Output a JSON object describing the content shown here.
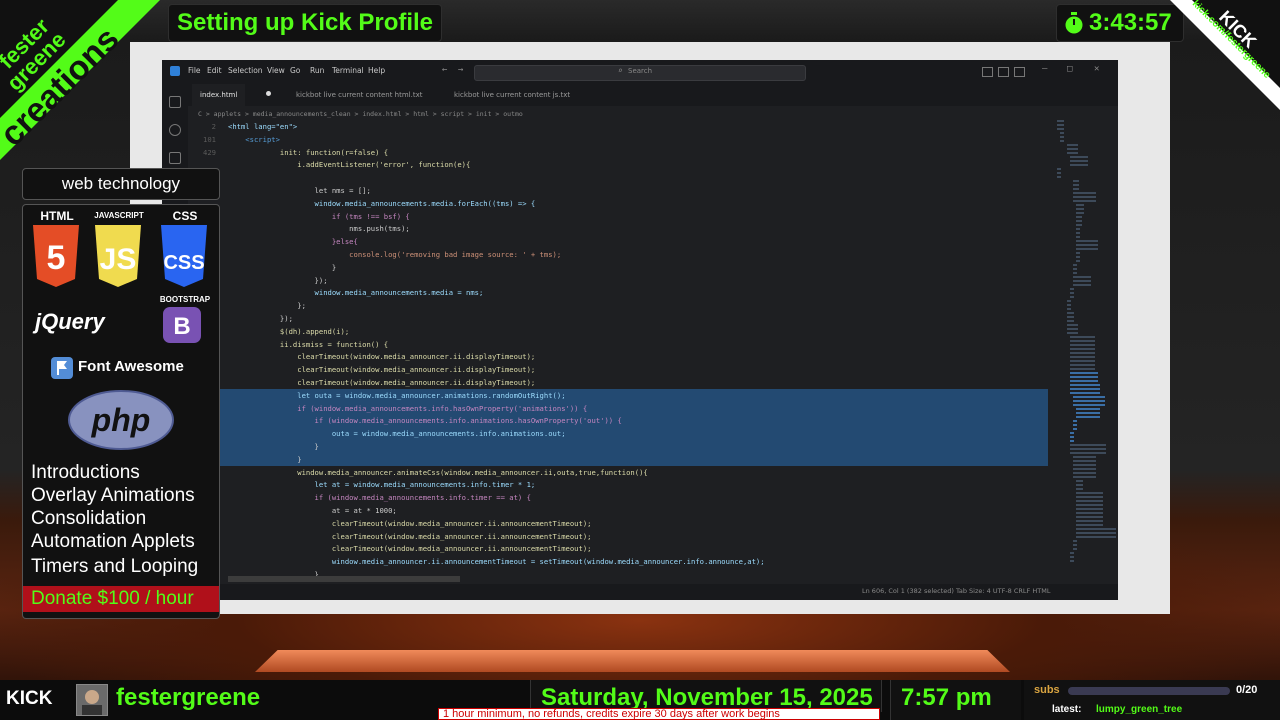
{
  "colors": {
    "accent": "#53fc18",
    "panel": "#111111",
    "donate_bg": "#b0101a",
    "ticker_text": "#cc0000",
    "subs_label": "#d9a441"
  },
  "header": {
    "title": "Setting up Kick Profile",
    "timer": "3:43:57",
    "logo_lines": [
      "fester",
      "greene",
      "creations"
    ],
    "kick_badge": "KICK",
    "kick_url": "kick.com/festergreene"
  },
  "left_panel": {
    "section_title": "web technology",
    "tech": [
      {
        "label": "HTML",
        "icon": "html5-icon"
      },
      {
        "label": "JAVASCRIPT",
        "icon": "javascript-icon"
      },
      {
        "label": "CSS",
        "icon": "css3-icon"
      },
      {
        "label": "jQuery",
        "icon": "jquery-icon"
      },
      {
        "label": "BOOTSTRAP",
        "icon": "bootstrap-icon"
      },
      {
        "label": "Font Awesome",
        "icon": "font-awesome-icon"
      },
      {
        "label": "php",
        "icon": "php-icon"
      }
    ],
    "topics": [
      "Introductions",
      "Overlay Animations",
      "Consolidation",
      "Automation Applets",
      "Timers and Looping"
    ],
    "donate": "Donate $100 / hour"
  },
  "editor": {
    "menu": [
      "File",
      "Edit",
      "Selection",
      "View",
      "Go",
      "Run",
      "Terminal",
      "Help"
    ],
    "search_placeholder": "Search",
    "tabs": [
      "index.html",
      "kickbot live current content html.txt",
      "kickbot live current content js.txt"
    ],
    "breadcrumbs": "C > applets > media_announcements_clean > index.html > html > script > init > outmo",
    "status": "Ln 606, Col 1 (382 selected)   Tab Size: 4   UTF-8   CRLF   HTML",
    "code_lines": [
      {
        "n": "2",
        "t": "<html lang=\"en\">",
        "c": "#9cdcfe",
        "sel": false
      },
      {
        "n": "101",
        "t": "    <script>",
        "c": "#569cd6",
        "sel": false
      },
      {
        "n": "429",
        "t": "            init: function(r=false) {",
        "c": "#dcdcaa",
        "sel": false
      },
      {
        "n": "",
        "t": "                i.addEventListener('error', function(e){",
        "c": "#dcdcaa",
        "sel": false
      },
      {
        "n": "",
        "t": "",
        "c": "#ccc",
        "sel": false
      },
      {
        "n": "",
        "t": "                    let nms = [];",
        "c": "#cccccc",
        "sel": false
      },
      {
        "n": "",
        "t": "                    window.media_announcements.media.forEach((tms) => {",
        "c": "#9cdcfe",
        "sel": false
      },
      {
        "n": "",
        "t": "                        if (tms !== bsf) {",
        "c": "#c586c0",
        "sel": false
      },
      {
        "n": "",
        "t": "                            nms.push(tms);",
        "c": "#cccccc",
        "sel": false
      },
      {
        "n": "",
        "t": "                        }else{",
        "c": "#c586c0",
        "sel": false
      },
      {
        "n": "",
        "t": "                            console.log('removing bad image source: ' + tms);",
        "c": "#ce9178",
        "sel": false
      },
      {
        "n": "",
        "t": "                        }",
        "c": "#cccccc",
        "sel": false
      },
      {
        "n": "",
        "t": "                    });",
        "c": "#cccccc",
        "sel": false
      },
      {
        "n": "",
        "t": "                    window.media_announcements.media = nms;",
        "c": "#9cdcfe",
        "sel": false
      },
      {
        "n": "",
        "t": "                };",
        "c": "#cccccc",
        "sel": false
      },
      {
        "n": "",
        "t": "            });",
        "c": "#cccccc",
        "sel": false
      },
      {
        "n": "",
        "t": "            $(dh).append(i);",
        "c": "#dcdcaa",
        "sel": false
      },
      {
        "n": "",
        "t": "            ii.dismiss = function() {",
        "c": "#dcdcaa",
        "sel": false
      },
      {
        "n": "",
        "t": "                clearTimeout(window.media_announcer.ii.displayTimeout);",
        "c": "#dcdcaa",
        "sel": false
      },
      {
        "n": "",
        "t": "                clearTimeout(window.media_announcer.ii.displayTimeout);",
        "c": "#dcdcaa",
        "sel": false
      },
      {
        "n": "",
        "t": "                clearTimeout(window.media_announcer.ii.displayTimeout);",
        "c": "#dcdcaa",
        "sel": false
      },
      {
        "n": "",
        "t": "                let outa = window.media_announcer.animations.randomOutRight();",
        "c": "#9cdcfe",
        "sel": true
      },
      {
        "n": "",
        "t": "                if (window.media_announcements.info.hasOwnProperty('animations')) {",
        "c": "#c586c0",
        "sel": true
      },
      {
        "n": "",
        "t": "                    if (window.media_announcements.info.animations.hasOwnProperty('out')) {",
        "c": "#c586c0",
        "sel": true
      },
      {
        "n": "",
        "t": "                        outa = window.media_announcements.info.animations.out;",
        "c": "#9cdcfe",
        "sel": true
      },
      {
        "n": "",
        "t": "                    }",
        "c": "#cccccc",
        "sel": true
      },
      {
        "n": "",
        "t": "                }",
        "c": "#cccccc",
        "sel": true
      },
      {
        "n": "",
        "t": "                window.media_announcer.animateCss(window.media_announcer.ii,outa,true,function(){",
        "c": "#dcdcaa",
        "sel": false
      },
      {
        "n": "",
        "t": "                    let at = window.media_announcements.info.timer * 1;",
        "c": "#9cdcfe",
        "sel": false
      },
      {
        "n": "",
        "t": "                    if (window.media_announcements.info.timer == at) {",
        "c": "#c586c0",
        "sel": false
      },
      {
        "n": "",
        "t": "                        at = at * 1000;",
        "c": "#cccccc",
        "sel": false
      },
      {
        "n": "",
        "t": "                        clearTimeout(window.media_announcer.ii.announcementTimeout);",
        "c": "#dcdcaa",
        "sel": false
      },
      {
        "n": "",
        "t": "                        clearTimeout(window.media_announcer.ii.announcementTimeout);",
        "c": "#dcdcaa",
        "sel": false
      },
      {
        "n": "",
        "t": "                        clearTimeout(window.media_announcer.ii.announcementTimeout);",
        "c": "#dcdcaa",
        "sel": false
      },
      {
        "n": "",
        "t": "                        window.media_announcer.ii.announcementTimeout = setTimeout(window.media_announcer.info.announce,at);",
        "c": "#9cdcfe",
        "sel": false
      },
      {
        "n": "",
        "t": "                    }",
        "c": "#cccccc",
        "sel": false
      },
      {
        "n": "",
        "t": "                });",
        "c": "#cccccc",
        "sel": false
      }
    ]
  },
  "bottom_bar": {
    "kick_logo": "KICK",
    "channel": "festergreene",
    "date": "Saturday, November 15, 2025",
    "time": "7:57 pm",
    "ticker": "1 hour minimum, no refunds, credits expire 30 days after work begins",
    "subs_label": "subs",
    "subs_count": "0/20",
    "subs_progress": 0,
    "latest_label": "latest:",
    "latest_name": "lumpy_green_tree"
  }
}
